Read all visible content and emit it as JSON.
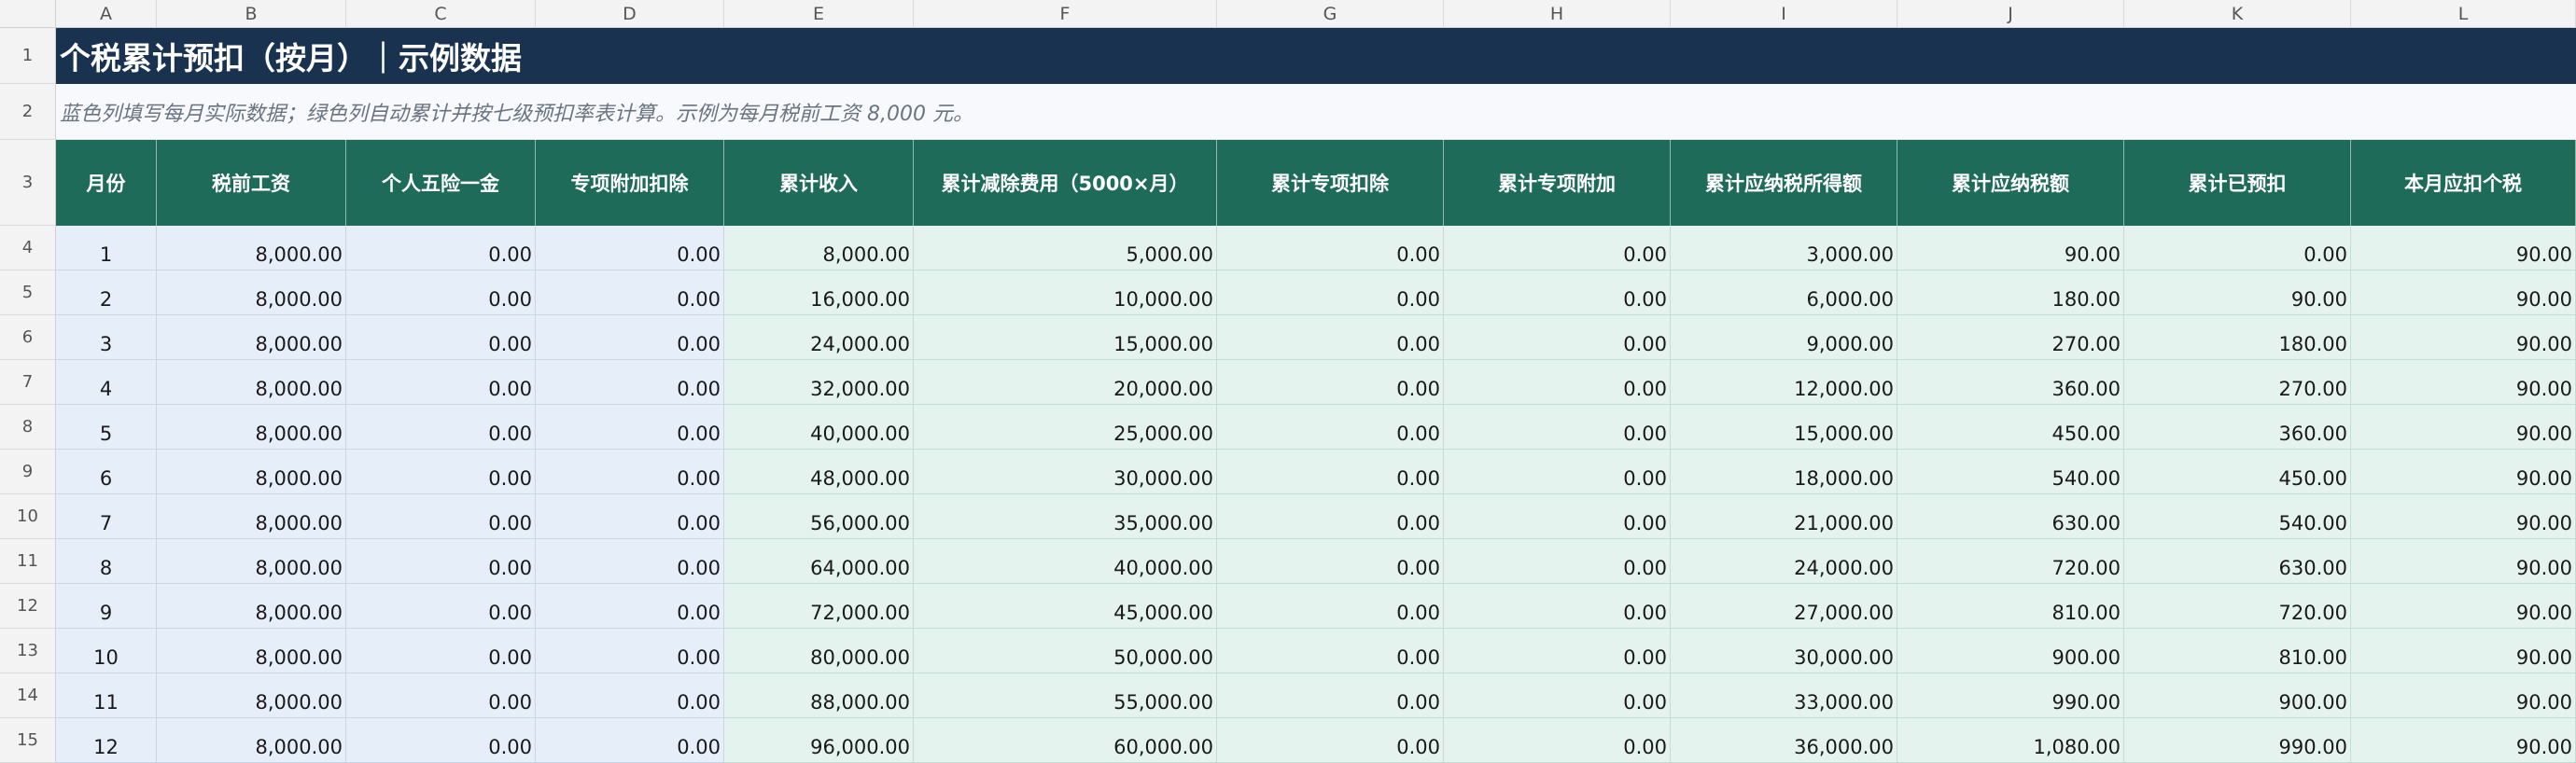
{
  "column_letters": [
    "A",
    "B",
    "C",
    "D",
    "E",
    "F",
    "G",
    "H",
    "I",
    "J",
    "K",
    "L"
  ],
  "row_numbers": [
    "1",
    "2",
    "3",
    "4",
    "5",
    "6",
    "7",
    "8",
    "9",
    "10",
    "11",
    "12",
    "13",
    "14",
    "15"
  ],
  "title": "个税累计预扣（按月）｜示例数据",
  "note": "蓝色列填写每月实际数据；绿色列自动累计并按七级预扣率表计算。示例为每月税前工资 8,000 元。",
  "headers": [
    "月份",
    "税前工资",
    "个人五险一金",
    "专项附加扣除",
    "累计收入",
    "累计减除费用（5000×月）",
    "累计专项扣除",
    "累计专项附加",
    "累计应纳税所得额",
    "累计应纳税额",
    "累计已预扣",
    "本月应扣个税"
  ],
  "colors": {
    "title_bg": "#19324f",
    "header_bg": "#1f6b5a",
    "input_bg": "#e6eff9",
    "calc_bg": "#e5f3ee"
  },
  "rows": [
    [
      "1",
      "8,000.00",
      "0.00",
      "0.00",
      "8,000.00",
      "5,000.00",
      "0.00",
      "0.00",
      "3,000.00",
      "90.00",
      "0.00",
      "90.00"
    ],
    [
      "2",
      "8,000.00",
      "0.00",
      "0.00",
      "16,000.00",
      "10,000.00",
      "0.00",
      "0.00",
      "6,000.00",
      "180.00",
      "90.00",
      "90.00"
    ],
    [
      "3",
      "8,000.00",
      "0.00",
      "0.00",
      "24,000.00",
      "15,000.00",
      "0.00",
      "0.00",
      "9,000.00",
      "270.00",
      "180.00",
      "90.00"
    ],
    [
      "4",
      "8,000.00",
      "0.00",
      "0.00",
      "32,000.00",
      "20,000.00",
      "0.00",
      "0.00",
      "12,000.00",
      "360.00",
      "270.00",
      "90.00"
    ],
    [
      "5",
      "8,000.00",
      "0.00",
      "0.00",
      "40,000.00",
      "25,000.00",
      "0.00",
      "0.00",
      "15,000.00",
      "450.00",
      "360.00",
      "90.00"
    ],
    [
      "6",
      "8,000.00",
      "0.00",
      "0.00",
      "48,000.00",
      "30,000.00",
      "0.00",
      "0.00",
      "18,000.00",
      "540.00",
      "450.00",
      "90.00"
    ],
    [
      "7",
      "8,000.00",
      "0.00",
      "0.00",
      "56,000.00",
      "35,000.00",
      "0.00",
      "0.00",
      "21,000.00",
      "630.00",
      "540.00",
      "90.00"
    ],
    [
      "8",
      "8,000.00",
      "0.00",
      "0.00",
      "64,000.00",
      "40,000.00",
      "0.00",
      "0.00",
      "24,000.00",
      "720.00",
      "630.00",
      "90.00"
    ],
    [
      "9",
      "8,000.00",
      "0.00",
      "0.00",
      "72,000.00",
      "45,000.00",
      "0.00",
      "0.00",
      "27,000.00",
      "810.00",
      "720.00",
      "90.00"
    ],
    [
      "10",
      "8,000.00",
      "0.00",
      "0.00",
      "80,000.00",
      "50,000.00",
      "0.00",
      "0.00",
      "30,000.00",
      "900.00",
      "810.00",
      "90.00"
    ],
    [
      "11",
      "8,000.00",
      "0.00",
      "0.00",
      "88,000.00",
      "55,000.00",
      "0.00",
      "0.00",
      "33,000.00",
      "990.00",
      "900.00",
      "90.00"
    ],
    [
      "12",
      "8,000.00",
      "0.00",
      "0.00",
      "96,000.00",
      "60,000.00",
      "0.00",
      "0.00",
      "36,000.00",
      "1,080.00",
      "990.00",
      "90.00"
    ]
  ]
}
